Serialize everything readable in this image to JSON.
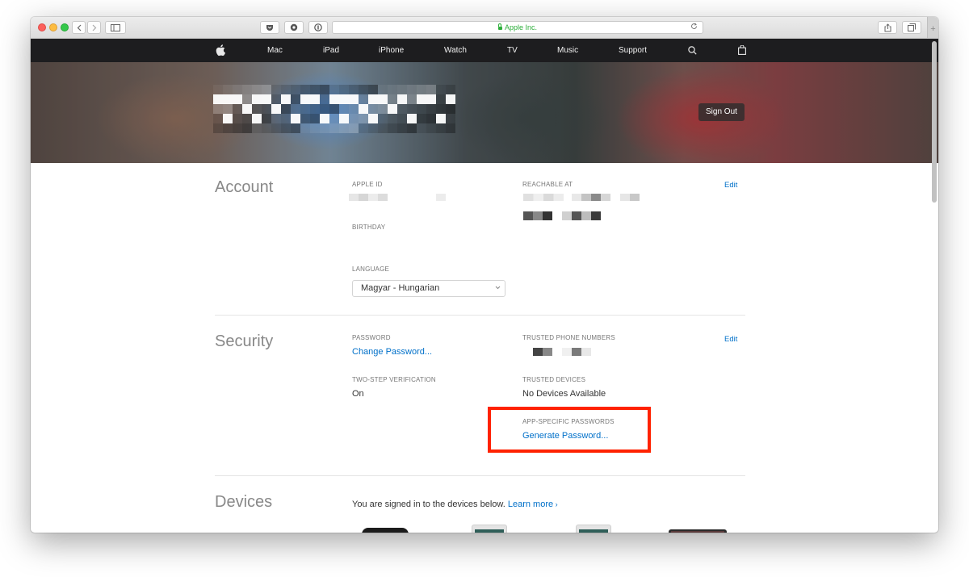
{
  "browser": {
    "url": "Apple Inc.",
    "reload_icon": "reload-icon",
    "share_icon": "share-icon",
    "tabs_icon": "tabs-icon",
    "new_tab": "+"
  },
  "nav": {
    "items": [
      "Mac",
      "iPad",
      "iPhone",
      "Watch",
      "TV",
      "Music",
      "Support"
    ],
    "logo_icon": "apple-logo-icon",
    "search_icon": "search-icon",
    "bag_icon": "bag-icon"
  },
  "hero": {
    "sign_out": "Sign Out"
  },
  "account": {
    "title": "Account",
    "apple_id_label": "APPLE ID",
    "reachable_label": "REACHABLE AT",
    "birthday_label": "BIRTHDAY",
    "language_label": "LANGUAGE",
    "language_value": "Magyar - Hungarian",
    "edit": "Edit"
  },
  "security": {
    "title": "Security",
    "password_label": "PASSWORD",
    "password_link": "Change Password...",
    "trusted_phone_label": "TRUSTED PHONE NUMBERS",
    "two_step_label": "TWO-STEP VERIFICATION",
    "two_step_value": "On",
    "trusted_devices_label": "TRUSTED DEVICES",
    "trusted_devices_value": "No Devices Available",
    "app_specific_label": "APP-SPECIFIC PASSWORDS",
    "app_specific_link": "Generate Password...",
    "edit": "Edit"
  },
  "devices": {
    "title": "Devices",
    "description": "You are signed in to the devices below.",
    "learn_more": "Learn more"
  },
  "colors": {
    "nav_bg": "#1d1d1f",
    "link": "#0070c9",
    "highlight": "#ff2200"
  }
}
